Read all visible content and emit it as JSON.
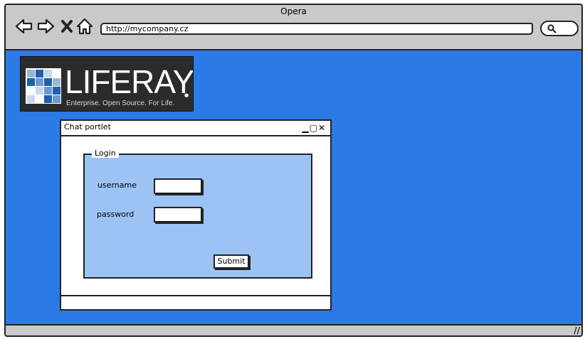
{
  "browser": {
    "title": "Opera",
    "address_url": "http://mycompany.cz"
  },
  "logo": {
    "wordmark": "LIFERAY",
    "tagline": "Enterprise. Open Source. For Life."
  },
  "portlet": {
    "title": "Chat portlet",
    "fieldset_legend": "Login",
    "username_label": "username",
    "password_label": "password",
    "username_value": "",
    "password_value": "",
    "submit_label": "Submit"
  },
  "colors": {
    "content_background": "#2b7ae6",
    "fieldset_background": "#9dc3f5",
    "chrome": "#c9c9c9"
  }
}
